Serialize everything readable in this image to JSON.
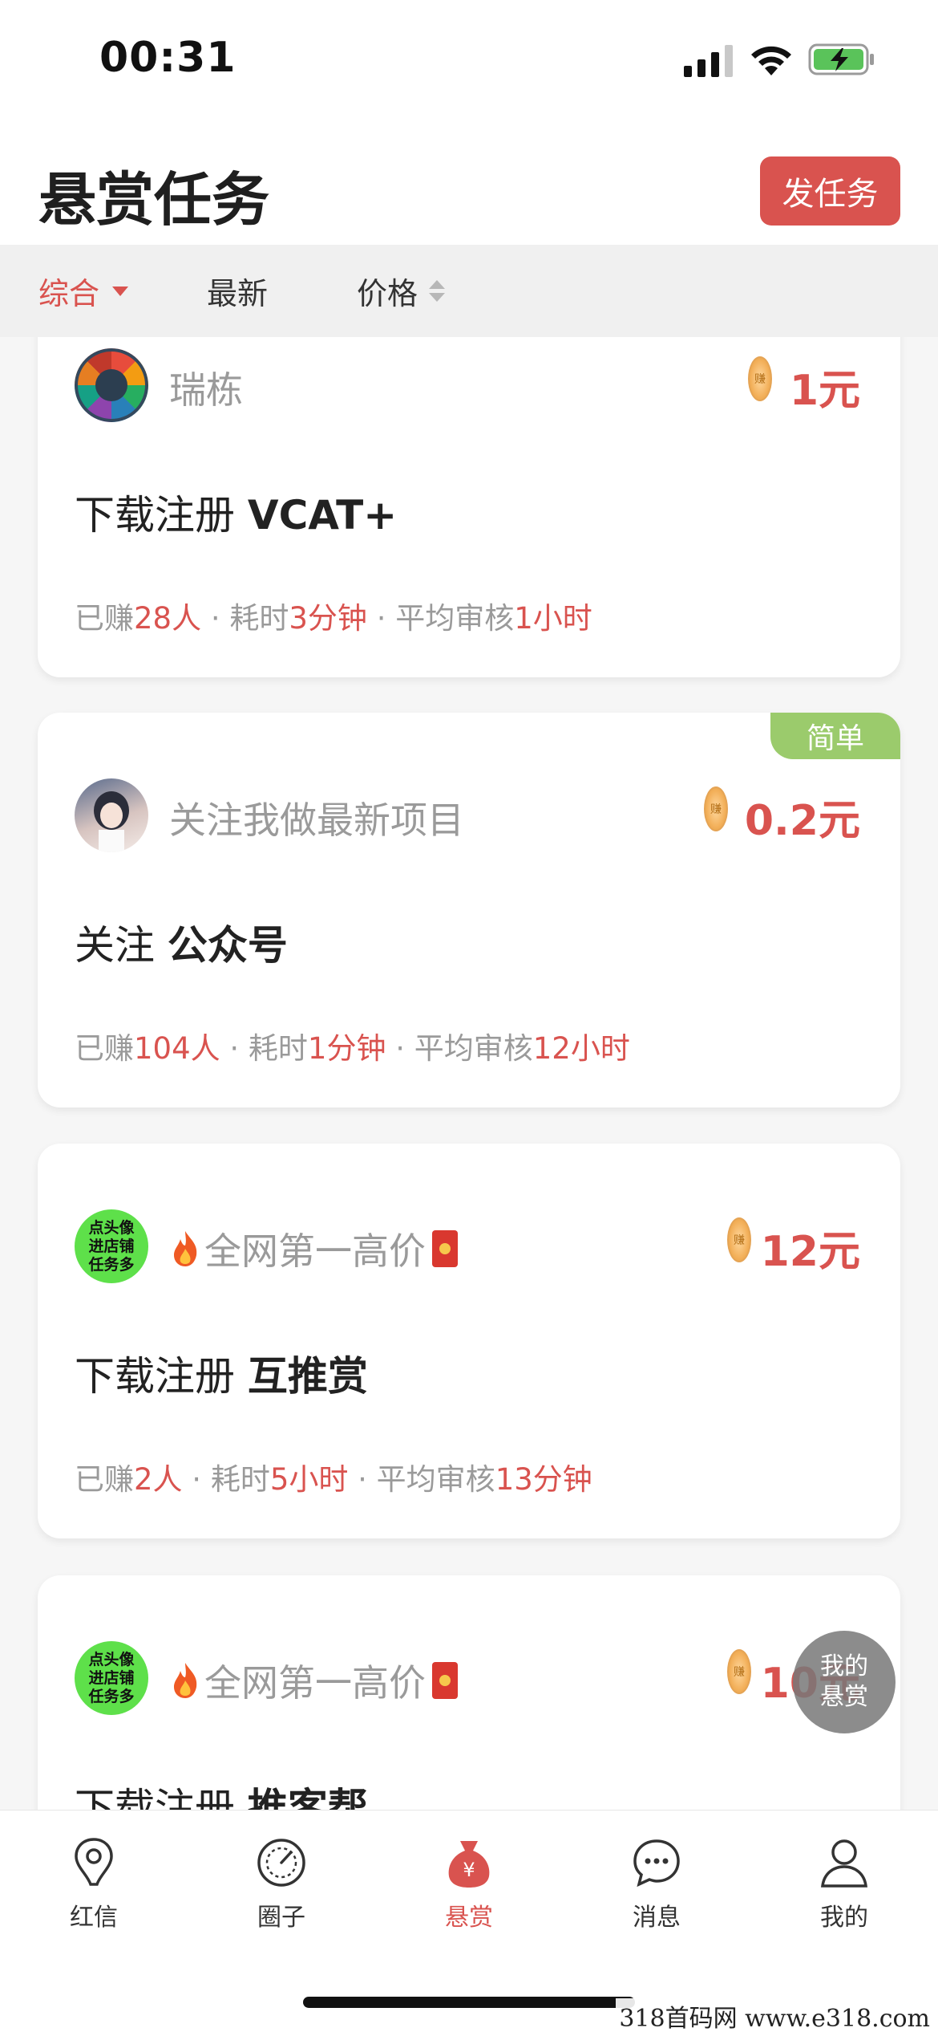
{
  "status_bar": {
    "time": "00:31"
  },
  "header": {
    "title": "悬赏任务",
    "publish_button": "发任务"
  },
  "filters": [
    {
      "label": "综合",
      "active": true
    },
    {
      "label": "最新",
      "active": false
    },
    {
      "label": "价格",
      "active": false
    }
  ],
  "tasks": [
    {
      "publisher": "瑞栋",
      "price": "1元",
      "action": "下载注册",
      "app": "VCAT+",
      "stats": {
        "earned_prefix": "已赚",
        "earned": "28人",
        "time_prefix": " · 耗时",
        "time": "3分钟",
        "review_prefix": " · 平均审核",
        "review": "1小时"
      }
    },
    {
      "badge": "简单",
      "publisher": "关注我做最新项目",
      "price": "0.2元",
      "action": "关注",
      "app": "公众号",
      "stats": {
        "earned_prefix": "已赚",
        "earned": "104人",
        "time_prefix": " · 耗时",
        "time": "1分钟",
        "review_prefix": " · 平均审核",
        "review": "12小时"
      }
    },
    {
      "publisher": "全网第一高价",
      "avatar_text": [
        "点头像",
        "进店铺",
        "任务多"
      ],
      "price": "12元",
      "action": "下载注册",
      "app": "互推赏",
      "stats": {
        "earned_prefix": "已赚",
        "earned": "2人",
        "time_prefix": " · 耗时",
        "time": "5小时",
        "review_prefix": " · 平均审核",
        "review": "13分钟"
      }
    },
    {
      "publisher": "全网第一高价",
      "avatar_text": [
        "点头像",
        "进店铺",
        "任务多"
      ],
      "price": "10元",
      "action": "下载注册",
      "app": "推客帮"
    }
  ],
  "coin_char": "赚",
  "float_button": {
    "line1": "我的",
    "line2": "悬赏"
  },
  "tabs": [
    {
      "label": "红信",
      "icon": "location-pin-icon"
    },
    {
      "label": "圈子",
      "icon": "compass-icon"
    },
    {
      "label": "悬赏",
      "icon": "money-bag-icon",
      "active": true
    },
    {
      "label": "消息",
      "icon": "chat-bubble-icon"
    },
    {
      "label": "我的",
      "icon": "person-icon"
    }
  ],
  "watermark": "318首码网  www.e318.com",
  "colors": {
    "accent": "#d9534f",
    "easy_badge": "#9bcb6c",
    "muted_text": "#9a9a9a"
  }
}
